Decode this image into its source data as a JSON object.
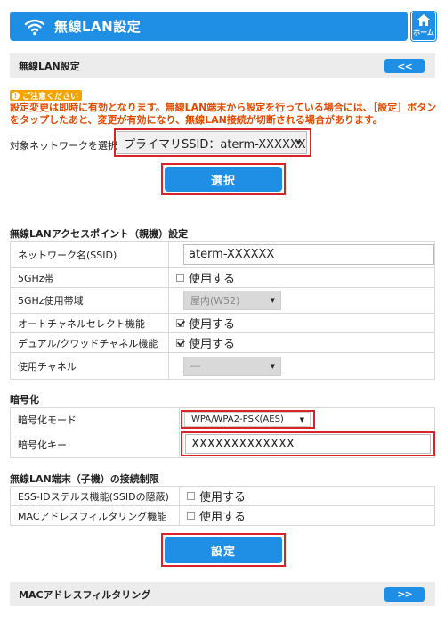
{
  "header": {
    "title": "無線LAN設定",
    "home_label": "ホーム"
  },
  "top_section": {
    "title": "無線LAN設定",
    "back_label": "<<"
  },
  "notice": {
    "badge": "ご注意ください",
    "text": "設定変更は即時に有効となります。無線LAN端末から設定を行っている場合には、［設定］ボタンをタップしたあと、変更が有効になり、無線LAN接続が切断される場合があります。"
  },
  "target": {
    "label": "対象ネットワークを選択",
    "selected": "プライマリSSID：aterm-XXXXXX",
    "select_button": "選択"
  },
  "ap_section": {
    "title": "無線LANアクセスポイント（親機）設定",
    "rows": {
      "ssid_label": "ネットワーク名(SSID)",
      "ssid_value": "aterm-XXXXXX",
      "ghz5_label": "5GHz帯",
      "ghz5_option": "使用する",
      "band_label": "5GHz使用帯域",
      "band_value": "屋内(W52)",
      "auto_label": "オートチャネルセレクト機能",
      "auto_option": "使用する",
      "dual_label": "デュアル/クワッドチャネル機能",
      "dual_option": "使用する",
      "channel_label": "使用チャネル",
      "channel_value": "―"
    }
  },
  "enc_section": {
    "title": "暗号化",
    "mode_label": "暗号化モード",
    "mode_value": "WPA/WPA2-PSK(AES)",
    "key_label": "暗号化キー",
    "key_value": "XXXXXXXXXXXXX"
  },
  "limit_section": {
    "title": "無線LAN端末（子機）の接続制限",
    "essid_label": "ESS-IDステルス機能(SSIDの隠蔽)",
    "essid_option": "使用する",
    "mac_label": "MACアドレスフィルタリング機能",
    "mac_option": "使用する"
  },
  "submit_label": "設定",
  "mac_section": {
    "title": "MACアドレスフィルタリング",
    "forward_label": ">>"
  }
}
